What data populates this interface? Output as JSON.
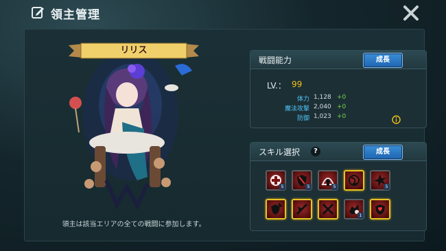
{
  "header": {
    "title": "領主管理",
    "edit_icon": "edit-icon",
    "close_icon": "close-icon"
  },
  "character": {
    "name": "リリス",
    "caption": "領主は該当エリアの全ての戦闘に参加します。"
  },
  "stats": {
    "title": "戦闘能力",
    "grow_label": "成長",
    "lv_label": "LV.：",
    "lv_value": "99",
    "rows": [
      {
        "name": "体力",
        "value": "1,128",
        "bonus": "+0"
      },
      {
        "name": "魔法攻撃",
        "value": "2,040",
        "bonus": "+0"
      },
      {
        "name": "防御",
        "value": "1,023",
        "bonus": "+0"
      }
    ],
    "info_icon": "info-icon"
  },
  "skills": {
    "title": "スキル選択",
    "help": "?",
    "grow_label": "成長",
    "items": [
      {
        "icon": "cross-icon",
        "level": "5",
        "selected": false
      },
      {
        "icon": "shield-icon",
        "level": "5",
        "selected": false
      },
      {
        "icon": "dome-icon",
        "level": "5",
        "selected": false
      },
      {
        "icon": "rune-icon",
        "level": "",
        "selected": true
      },
      {
        "icon": "burst-icon",
        "level": "5",
        "selected": false
      },
      {
        "icon": "shield-strike-icon",
        "level": "",
        "selected": true
      },
      {
        "icon": "slash-icon",
        "level": "",
        "selected": true
      },
      {
        "icon": "crossed-swords-icon",
        "level": "",
        "selected": true
      },
      {
        "icon": "beast-icon",
        "level": "1",
        "selected": false
      },
      {
        "icon": "heart-shield-icon",
        "level": "",
        "selected": true
      }
    ]
  },
  "colors": {
    "accent_blue": "#2f7fd0",
    "gold": "#e8c224",
    "level_yellow": "#f2c418",
    "bonus_green": "#7bd14a",
    "stat_label": "#4fc3f7"
  }
}
